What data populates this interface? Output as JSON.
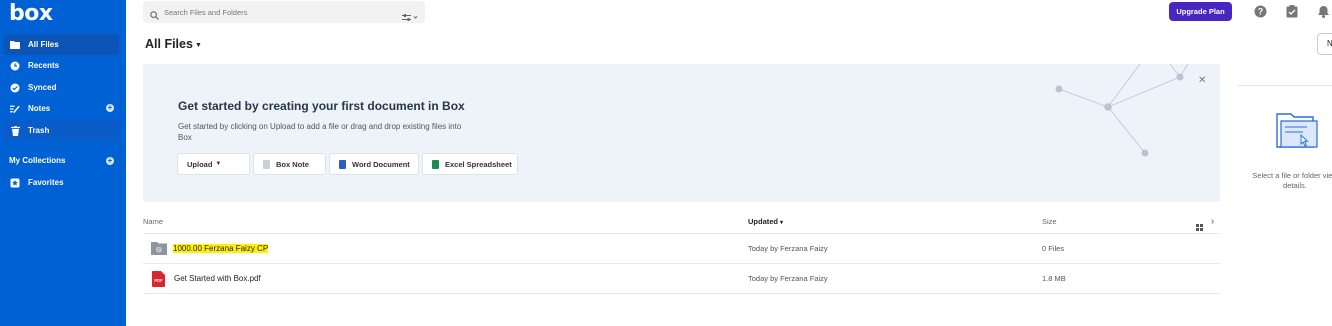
{
  "brand": {
    "logo": "box"
  },
  "sidebar": {
    "items": [
      {
        "label": "All Files",
        "icon": "folder-icon"
      },
      {
        "label": "Recents",
        "icon": "clock-icon"
      },
      {
        "label": "Synced",
        "icon": "check-circle-icon"
      },
      {
        "label": "Notes",
        "icon": "notes-icon"
      },
      {
        "label": "Trash",
        "icon": "trash-icon"
      }
    ],
    "collections_label": "My Collections",
    "favorites_label": "Favorites"
  },
  "header": {
    "search_placeholder": "Search Files and Folders",
    "upgrade_label": "Upgrade Plan",
    "new_label": "N"
  },
  "page": {
    "title": "All Files"
  },
  "banner": {
    "title": "Get started by creating your first document in Box",
    "description": "Get started by clicking on Upload to add a file or drag and drop existing files into Box",
    "buttons": {
      "upload": "Upload",
      "box_note": "Box Note",
      "word": "Word Document",
      "excel": "Excel Spreadsheet"
    }
  },
  "table": {
    "columns": {
      "name": "Name",
      "updated": "Updated",
      "size": "Size"
    },
    "rows": [
      {
        "name": "1000.00 Ferzana Faizy CP",
        "updated": "Today by Ferzana Faizy",
        "size": "0 Files",
        "type": "shared-folder-icon"
      },
      {
        "name": "Get Started with Box.pdf",
        "updated": "Today by Ferzana Faizy",
        "size": "1.8 MB",
        "type": "pdf-icon"
      }
    ]
  },
  "details_panel": {
    "text": "Select a file or folder view details."
  },
  "colors": {
    "sidebar": "#0061d5",
    "upgrade": "#4826c2",
    "banner": "#eef3fa",
    "highlight": "#fff200"
  }
}
